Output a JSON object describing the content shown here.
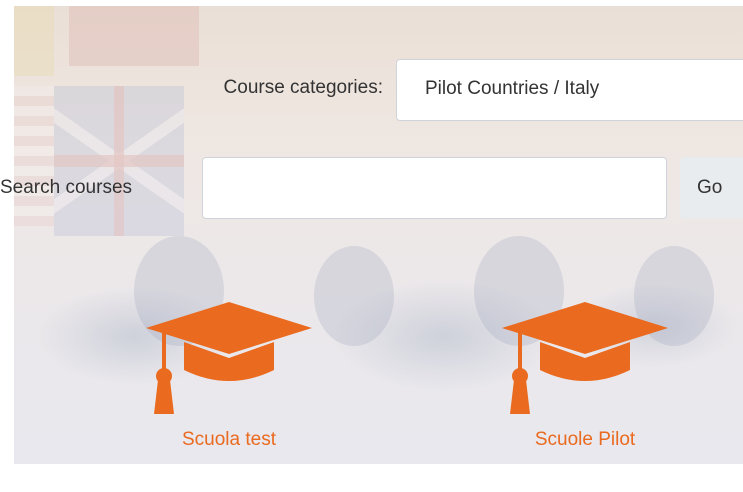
{
  "form": {
    "category_label": "Course categories:",
    "category_selected": "Pilot Countries / Italy",
    "search_label": "Search courses",
    "search_value": "",
    "go_label": "Go"
  },
  "categories": [
    {
      "name": "Scuola test",
      "icon": "graduation-cap-icon"
    },
    {
      "name": "Scuole Pilot",
      "icon": "graduation-cap-icon"
    }
  ],
  "colors": {
    "accent": "#ea6a1f"
  }
}
